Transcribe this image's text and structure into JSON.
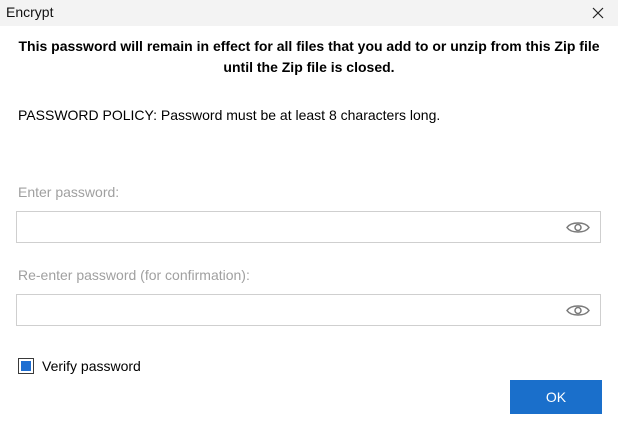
{
  "window": {
    "title": "Encrypt"
  },
  "dialog": {
    "notice": "This password will remain in effect for all files that you add to or unzip from this Zip file until the Zip file is closed.",
    "policy": "PASSWORD POLICY: Password must be at least 8 characters long."
  },
  "fields": {
    "password_label": "Enter password:",
    "password_value": "",
    "confirm_label": "Re-enter password (for confirmation):",
    "confirm_value": ""
  },
  "options": {
    "verify_label": "Verify password",
    "verify_checked": true
  },
  "buttons": {
    "ok_label": "OK"
  },
  "icons": {
    "close": "close-icon",
    "show_password": "eye-icon"
  },
  "colors": {
    "accent": "#1a6fcb",
    "checkbox_fill": "#1e6ed1"
  }
}
